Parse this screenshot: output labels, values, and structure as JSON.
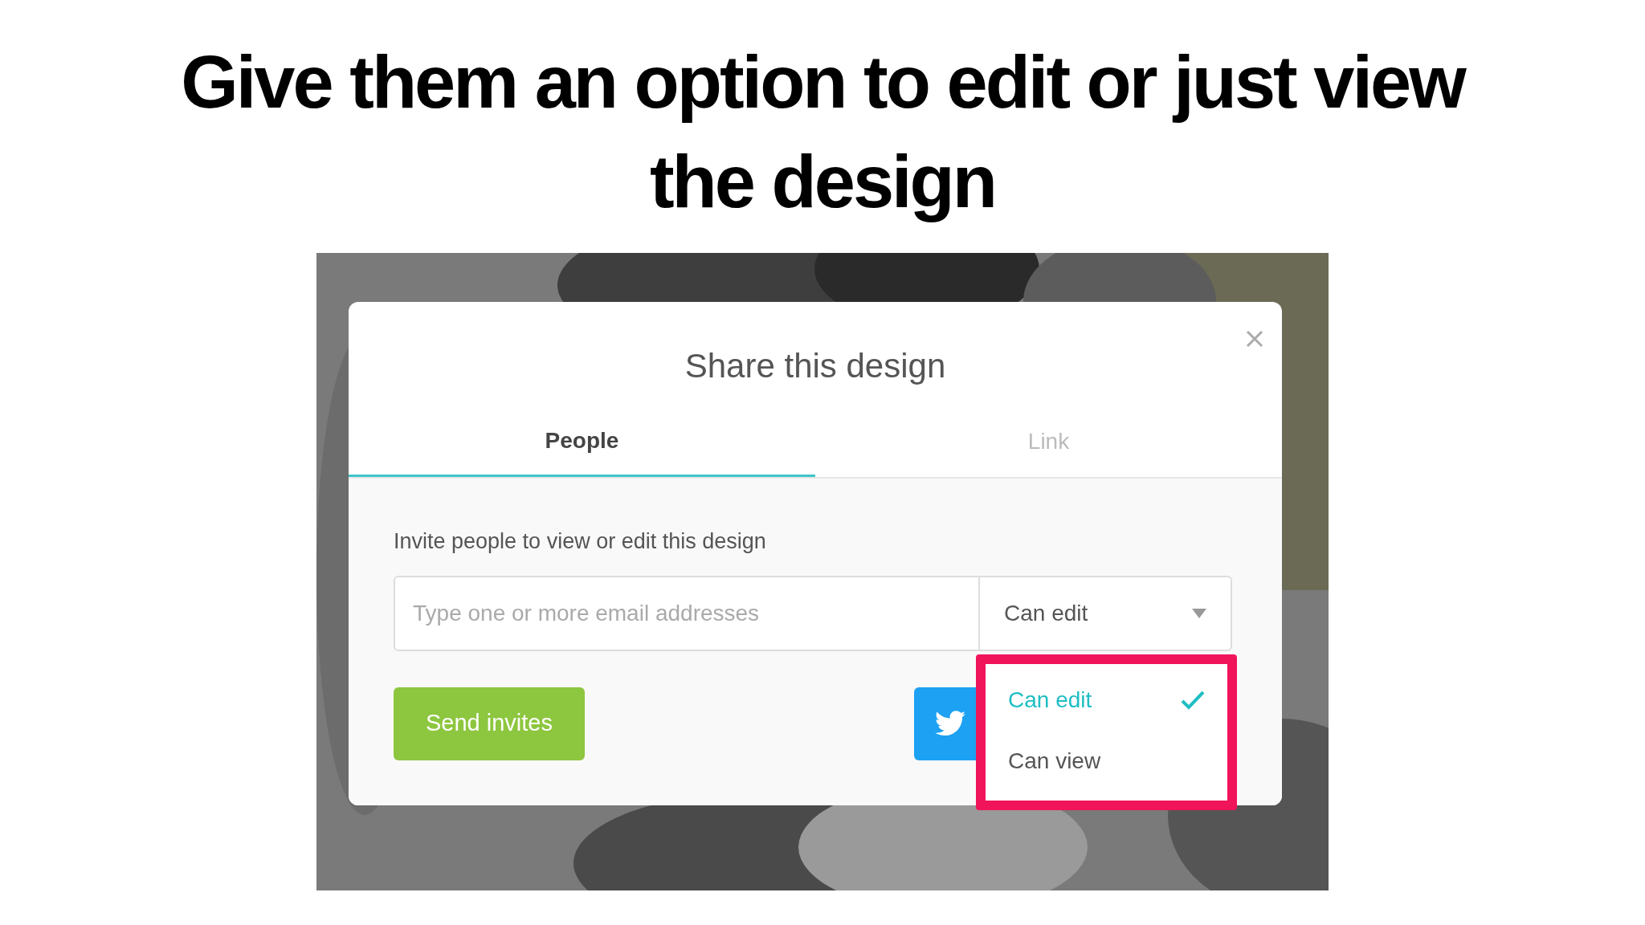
{
  "heading": "Give them an option to edit or just view the design",
  "dialog": {
    "title": "Share this design",
    "tabs": [
      {
        "label": "People",
        "selected": true
      },
      {
        "label": "Link",
        "selected": false
      }
    ],
    "prompt": "Invite people to view or edit this design",
    "email_field": {
      "placeholder": "Type one or more email addresses"
    },
    "permission_select": {
      "value": "Can edit"
    },
    "send_button": "Send invites",
    "permission_menu": {
      "items": [
        {
          "label": "Can edit",
          "selected": true
        },
        {
          "label": "Can view",
          "selected": false
        }
      ]
    }
  }
}
